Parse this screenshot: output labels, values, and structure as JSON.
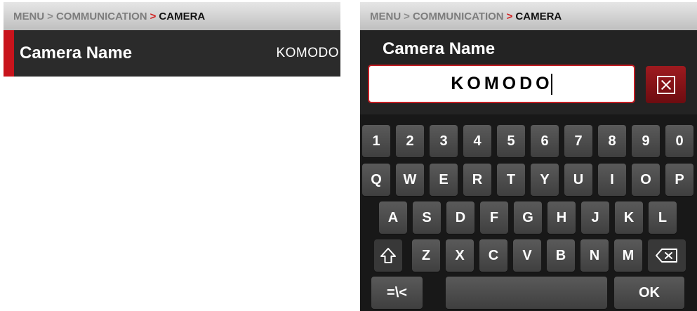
{
  "breadcrumb": {
    "menu": "MENU",
    "sep": ">",
    "section": "COMMUNICATION",
    "sep_active": ">",
    "current": "CAMERA"
  },
  "menu_row": {
    "label": "Camera Name",
    "value": "KOMODO"
  },
  "keyboard_screen": {
    "title": "Camera Name",
    "input_value": "KOMODO",
    "clear_icon": "clear-x-icon"
  },
  "keyboard": {
    "row1": [
      "1",
      "2",
      "3",
      "4",
      "5",
      "6",
      "7",
      "8",
      "9",
      "0"
    ],
    "row2": [
      "Q",
      "W",
      "E",
      "R",
      "T",
      "Y",
      "U",
      "I",
      "O",
      "P"
    ],
    "row3": [
      "A",
      "S",
      "D",
      "F",
      "G",
      "H",
      "J",
      "K",
      "L"
    ],
    "row4": [
      "Z",
      "X",
      "C",
      "V",
      "B",
      "N",
      "M"
    ],
    "shift_icon": "shift-icon",
    "backspace_icon": "backspace-icon",
    "symbols_label": "=\\<",
    "ok_label": "OK"
  },
  "colors": {
    "accent": "#c8141c",
    "panel_bg": "#2b2b2b",
    "key_bg": "#4a4a4a"
  }
}
